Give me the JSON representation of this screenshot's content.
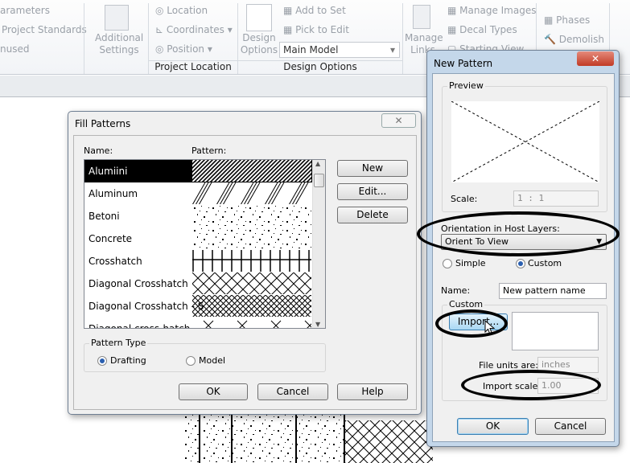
{
  "ribbon": {
    "items": [
      "arameters",
      "Project Standards",
      "nused",
      "Additional Settings",
      "Location",
      "Coordinates",
      "Position",
      "Design Options",
      "Add to Set",
      "Pick to Edit",
      "Main Model",
      "Manage Links",
      "Manage Images",
      "Decal Types",
      "Starting View",
      "Phases",
      "Demolish"
    ],
    "panels": {
      "project_location": "Project Location",
      "design_options": "Design Options"
    }
  },
  "fill_patterns": {
    "title": "Fill Patterns",
    "col_name": "Name:",
    "col_pattern": "Pattern:",
    "rows": [
      {
        "name": "Alumiini",
        "pattern": "diagonal-dense",
        "selected": true
      },
      {
        "name": "Aluminum",
        "pattern": "diagonal-triple"
      },
      {
        "name": "Betoni",
        "pattern": "dots"
      },
      {
        "name": "Concrete",
        "pattern": "dots"
      },
      {
        "name": "Crosshatch",
        "pattern": "grid"
      },
      {
        "name": "Diagonal Crosshatch",
        "pattern": "diamond"
      },
      {
        "name": "Diagonal Crosshatch - S",
        "pattern": "diamond-small"
      },
      {
        "name": "Diagonal cross-hatch",
        "pattern": "x-sparse"
      }
    ],
    "buttons": {
      "new": "New",
      "edit": "Edit...",
      "delete": "Delete",
      "ok": "OK",
      "cancel": "Cancel",
      "help": "Help"
    },
    "pattern_type": {
      "label": "Pattern Type",
      "drafting": "Drafting",
      "model": "Model",
      "selected": "Drafting"
    }
  },
  "new_pattern": {
    "title": "New Pattern",
    "preview_label": "Preview",
    "scale_label": "Scale:",
    "scale_value": "1 : 1",
    "orientation_label": "Orientation in Host Layers:",
    "orientation_value": "Orient To View",
    "simple": "Simple",
    "custom": "Custom",
    "selected_type": "Custom",
    "name_label": "Name:",
    "name_value": "New pattern name",
    "custom_group": "Custom",
    "import": "Import...",
    "file_units_label": "File units are:",
    "file_units_value": "inches",
    "import_scale_label": "Import scale:",
    "import_scale_value": "1.00",
    "ok": "OK",
    "cancel": "Cancel"
  }
}
